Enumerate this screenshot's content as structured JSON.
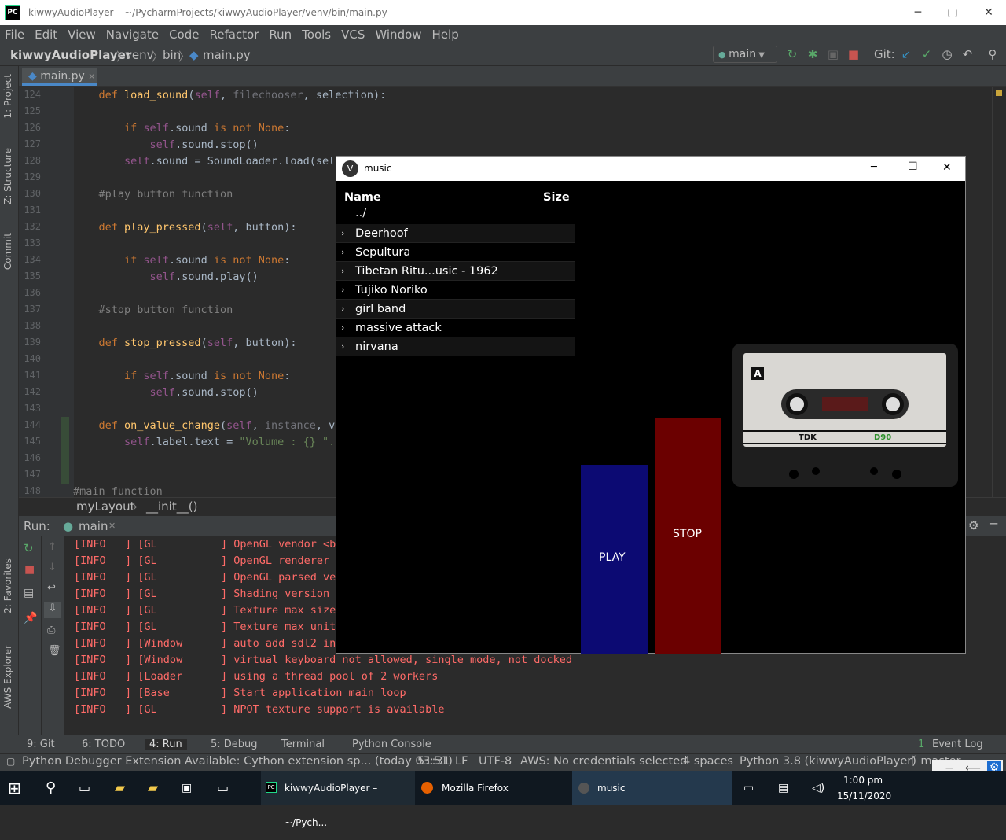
{
  "window": {
    "title": "kiwwyAudioPlayer – ~/PycharmProjects/kiwwyAudioPlayer/venv/bin/main.py",
    "minimize": "─",
    "maximize": "▢",
    "close": "✕",
    "logo": "PC"
  },
  "menu": [
    "File",
    "Edit",
    "View",
    "Navigate",
    "Code",
    "Refactor",
    "Run",
    "Tools",
    "VCS",
    "Window",
    "Help"
  ],
  "nav": {
    "project": "kiwwyAudioPlayer",
    "crumbs": [
      "venv",
      "bin"
    ],
    "file": "main.py",
    "branch": "main",
    "git_label": "Git:"
  },
  "left_tabs": [
    "1: Project",
    "Z: Structure",
    "Commit",
    "2: Favorites",
    "AWS Explorer"
  ],
  "editor": {
    "tab": "main.py",
    "line_numbers": [
      "124",
      "125",
      "126",
      "127",
      "128",
      "129",
      "130",
      "131",
      "132",
      "133",
      "134",
      "135",
      "136",
      "137",
      "138",
      "139",
      "140",
      "141",
      "142",
      "143",
      "144",
      "145",
      "146",
      "147",
      "148"
    ],
    "lines": [
      [
        {
          "t": "    "
        },
        {
          "t": "def ",
          "c": "kw"
        },
        {
          "t": "load_sound",
          "c": "fn"
        },
        {
          "t": "("
        },
        {
          "t": "self",
          "c": "sf"
        },
        {
          "t": ", "
        },
        {
          "t": "filechooser",
          "c": "pr"
        },
        {
          "t": ", selection):"
        }
      ],
      [],
      [
        {
          "t": "        "
        },
        {
          "t": "if ",
          "c": "kw"
        },
        {
          "t": "self",
          "c": "sf"
        },
        {
          "t": ".sound "
        },
        {
          "t": "is not None",
          "c": "kw"
        },
        {
          "t": ":"
        }
      ],
      [
        {
          "t": "            "
        },
        {
          "t": "self",
          "c": "sf"
        },
        {
          "t": ".sound.stop()"
        }
      ],
      [
        {
          "t": "        "
        },
        {
          "t": "self",
          "c": "sf"
        },
        {
          "t": ".sound = SoundLoader.load(sele"
        }
      ],
      [],
      [
        {
          "t": "    "
        },
        {
          "t": "#play button function",
          "c": "cm"
        }
      ],
      [],
      [
        {
          "t": "    "
        },
        {
          "t": "def ",
          "c": "kw"
        },
        {
          "t": "play_pressed",
          "c": "fn"
        },
        {
          "t": "("
        },
        {
          "t": "self",
          "c": "sf"
        },
        {
          "t": ", button):"
        }
      ],
      [],
      [
        {
          "t": "        "
        },
        {
          "t": "if ",
          "c": "kw"
        },
        {
          "t": "self",
          "c": "sf"
        },
        {
          "t": ".sound "
        },
        {
          "t": "is not None",
          "c": "kw"
        },
        {
          "t": ":"
        }
      ],
      [
        {
          "t": "            "
        },
        {
          "t": "self",
          "c": "sf"
        },
        {
          "t": ".sound.play()"
        }
      ],
      [],
      [
        {
          "t": "    "
        },
        {
          "t": "#stop button function",
          "c": "cm"
        }
      ],
      [],
      [
        {
          "t": "    "
        },
        {
          "t": "def ",
          "c": "kw"
        },
        {
          "t": "stop_pressed",
          "c": "fn"
        },
        {
          "t": "("
        },
        {
          "t": "self",
          "c": "sf"
        },
        {
          "t": ", button):"
        }
      ],
      [],
      [
        {
          "t": "        "
        },
        {
          "t": "if ",
          "c": "kw"
        },
        {
          "t": "self",
          "c": "sf"
        },
        {
          "t": ".sound "
        },
        {
          "t": "is not None",
          "c": "kw"
        },
        {
          "t": ":"
        }
      ],
      [
        {
          "t": "            "
        },
        {
          "t": "self",
          "c": "sf"
        },
        {
          "t": ".sound.stop()"
        }
      ],
      [],
      [
        {
          "t": "    "
        },
        {
          "t": "def ",
          "c": "kw"
        },
        {
          "t": "on_value_change",
          "c": "fn"
        },
        {
          "t": "("
        },
        {
          "t": "self",
          "c": "sf"
        },
        {
          "t": ", "
        },
        {
          "t": "instance",
          "c": "pr"
        },
        {
          "t": ", va"
        }
      ],
      [
        {
          "t": "        "
        },
        {
          "t": "self",
          "c": "sf"
        },
        {
          "t": ".label.text = "
        },
        {
          "t": "\"Volume : {} \".f",
          "c": "st"
        }
      ],
      [],
      [],
      [
        {
          "t": "#main function",
          "c": "cm"
        }
      ]
    ],
    "breadcrumb": [
      "myLayout",
      "__init__()"
    ]
  },
  "run": {
    "label": "Run:",
    "tab": "main",
    "log": [
      {
        "level": "[INFO   ]",
        "src": "[GL          ]",
        "msg": "OpenGL vendor <b'"
      },
      {
        "level": "[INFO   ]",
        "src": "[GL          ]",
        "msg": "OpenGL renderer <"
      },
      {
        "level": "[INFO   ]",
        "src": "[GL          ]",
        "msg": "OpenGL parsed ver"
      },
      {
        "level": "[INFO   ]",
        "src": "[GL          ]",
        "msg": "Shading version <"
      },
      {
        "level": "[INFO   ]",
        "src": "[GL          ]",
        "msg": "Texture max size"
      },
      {
        "level": "[INFO   ]",
        "src": "[GL          ]",
        "msg": "Texture max units"
      },
      {
        "level": "[INFO   ]",
        "src": "[Window      ]",
        "msg": "auto add sdl2 inp"
      },
      {
        "level": "[INFO   ]",
        "src": "[Window      ]",
        "msg": "virtual keyboard not allowed, single mode, not docked"
      },
      {
        "level": "[INFO   ]",
        "src": "[Loader      ]",
        "msg": "using a thread pool of 2 workers"
      },
      {
        "level": "[INFO   ]",
        "src": "[Base        ]",
        "msg": "Start application main loop"
      },
      {
        "level": "[INFO   ]",
        "src": "[GL          ]",
        "msg": "NPOT texture support is available"
      }
    ]
  },
  "bottom_tabs": {
    "git": "9: Git",
    "todo": "6: TODO",
    "run": "4: Run",
    "debug": "5: Debug",
    "terminal": "Terminal",
    "console": "Python Console",
    "eventlog": "Event Log",
    "eventlog_count": "1"
  },
  "status": {
    "message": "Python Debugger Extension Available: Cython extension sp... (today 03:51)",
    "position": "51:31",
    "eol": "LF",
    "encoding": "UTF-8",
    "aws": "AWS: No credentials selected",
    "indent": "4 spaces",
    "interpreter": "Python 3.8 (kiwwyAudioPlayer)",
    "vcs": "master"
  },
  "kivy": {
    "title": "music",
    "col_name": "Name",
    "col_size": "Size",
    "parent": "../",
    "folders": [
      "Deerhoof",
      "Sepultura",
      "Tibetan Ritu...usic - 1962",
      "Tujiko Noriko",
      "girl band",
      "massive attack",
      "nirvana"
    ],
    "play": "PLAY",
    "stop": "STOP",
    "tape_side": "A",
    "tape_brand": "TDK",
    "tape_type": "D90"
  },
  "taskbar": {
    "pycharm": "kiwwyAudioPlayer – ~/Pych...",
    "firefox": "Mozilla Firefox",
    "music": "music",
    "time": "1:00 pm",
    "date": "15/11/2020"
  },
  "colors": {
    "play": "#0c0a73",
    "stop": "#6b0000",
    "error_text": "#ff6b68",
    "accent": "#4a88c7"
  }
}
